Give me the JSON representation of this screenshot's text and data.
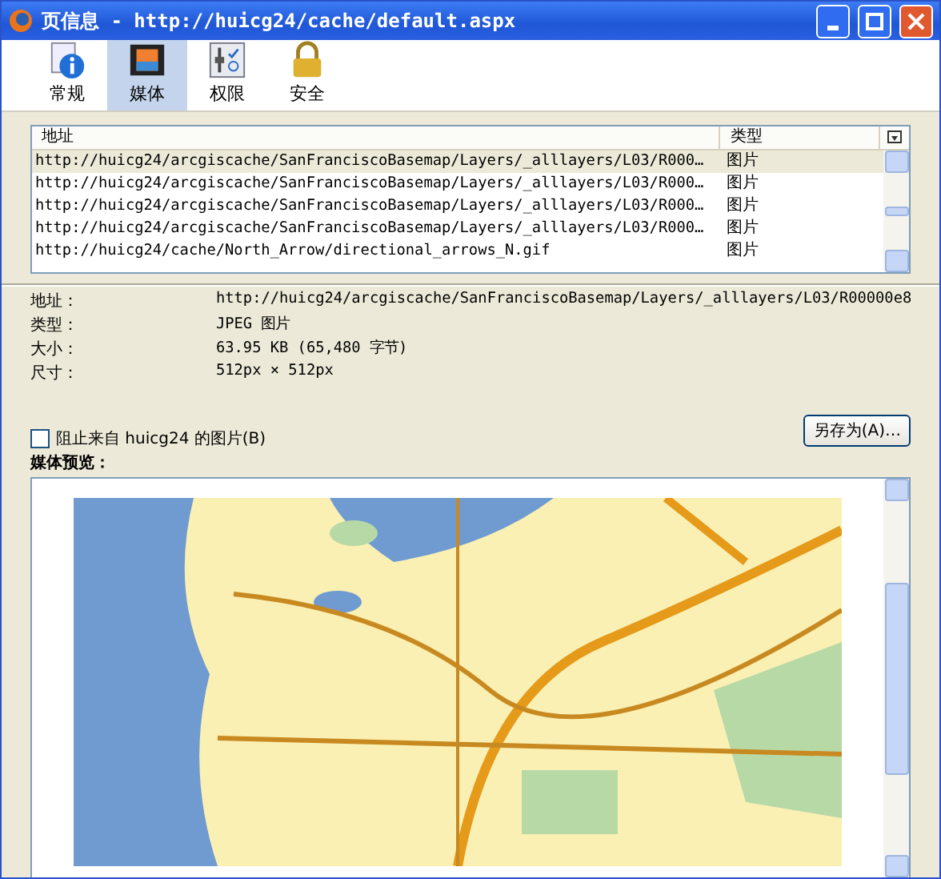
{
  "window": {
    "title": "页信息 - http://huicg24/cache/default.aspx"
  },
  "tabs": [
    {
      "label": "常规",
      "kind": "info",
      "selected": false
    },
    {
      "label": "媒体",
      "kind": "media",
      "selected": true
    },
    {
      "label": "权限",
      "kind": "permissions",
      "selected": false
    },
    {
      "label": "安全",
      "kind": "lock",
      "selected": false
    }
  ],
  "media_list": {
    "columns": [
      "地址",
      "类型"
    ],
    "rows": [
      {
        "address": "http://huicg24/arcgiscache/SanFranciscoBasemap/Layers/_alllayers/L03/R000…",
        "type": "图片",
        "selected": true
      },
      {
        "address": "http://huicg24/arcgiscache/SanFranciscoBasemap/Layers/_alllayers/L03/R000…",
        "type": "图片",
        "selected": false
      },
      {
        "address": "http://huicg24/arcgiscache/SanFranciscoBasemap/Layers/_alllayers/L03/R000…",
        "type": "图片",
        "selected": false
      },
      {
        "address": "http://huicg24/arcgiscache/SanFranciscoBasemap/Layers/_alllayers/L03/R000…",
        "type": "图片",
        "selected": false
      },
      {
        "address": "http://huicg24/cache/North_Arrow/directional_arrows_N.gif",
        "type": "图片",
        "selected": false
      }
    ]
  },
  "details": [
    {
      "label": "地址：",
      "value": "http://huicg24/arcgiscache/SanFranciscoBasemap/Layers/_alllayers/L03/R00000e8"
    },
    {
      "label": "类型：",
      "value": "JPEG 图片"
    },
    {
      "label": "大小：",
      "value": "63.95 KB (65,480 字节)"
    },
    {
      "label": "尺寸：",
      "value": "512px × 512px"
    }
  ],
  "block_checkbox": {
    "label": "阻止来自 huicg24 的图片(B)",
    "checked": false
  },
  "save_button": "另存为(A)…",
  "preview_label": "媒体预览："
}
